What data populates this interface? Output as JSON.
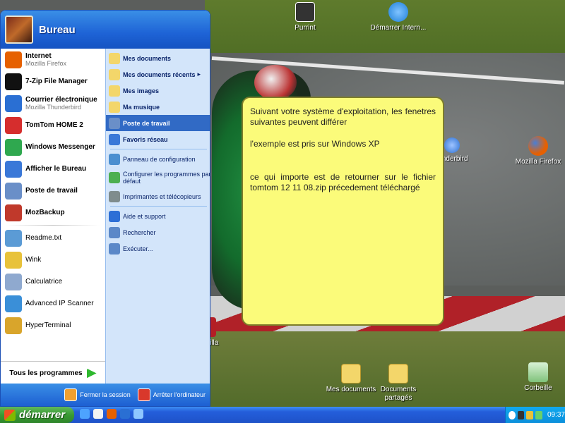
{
  "desktop": {
    "icons": [
      {
        "label": "Purrint",
        "icon": "purrint-icon",
        "color": "#333333"
      },
      {
        "label": "Démarrer Intern...",
        "icon": "internet-explorer-icon",
        "color": "#1e7fd8"
      },
      {
        "label": "Mozilla Firefox",
        "icon": "firefox-icon",
        "color": "#e66000"
      },
      {
        "label": "Mes documents",
        "icon": "my-documents-icon",
        "color": "#f3d66a"
      },
      {
        "label": "Documents partagés",
        "icon": "shared-documents-icon",
        "color": "#f3d66a"
      },
      {
        "label": "Corbeille",
        "icon": "recycle-bin-icon",
        "color": "#7fc27a"
      },
      {
        "label": "...Zilla",
        "icon": "filezilla-icon",
        "color": "#b41e25"
      },
      {
        "label": "...nderbird",
        "icon": "thunderbird-icon",
        "color": "#2a6fd3"
      }
    ]
  },
  "note": {
    "paragraphs": [
      "Suivant votre système d'exploitation, les fenetres suivantes peuvent différer",
      "l'exemple est pris sur Windows XP",
      "ce qui importe est de retourner sur le fichier tomtom 12 11 08.zip  précedement téléchargé"
    ]
  },
  "startmenu": {
    "username": "Bureau",
    "left_items": [
      {
        "title": "Internet",
        "subtitle": "Mozilla Firefox",
        "icon": "firefox-icon",
        "color": "#e66000",
        "bold": true
      },
      {
        "title": "7-Zip File Manager",
        "subtitle": "",
        "icon": "seven-zip-icon",
        "color": "#111111",
        "bold": true
      },
      {
        "title": "Courrier électronique",
        "subtitle": "Mozilla Thunderbird",
        "icon": "thunderbird-icon",
        "color": "#2a6fd3",
        "bold": true
      },
      {
        "title": "TomTom HOME 2",
        "subtitle": "",
        "icon": "tomtom-icon",
        "color": "#d62d2d",
        "bold": true
      },
      {
        "title": "Windows Messenger",
        "subtitle": "",
        "icon": "messenger-icon",
        "color": "#2fa84f",
        "bold": true
      },
      {
        "title": "Afficher le Bureau",
        "subtitle": "",
        "icon": "show-desktop-icon",
        "color": "#3a78d8",
        "bold": true
      },
      {
        "title": "Poste de travail",
        "subtitle": "",
        "icon": "my-computer-icon",
        "color": "#6a8fc8",
        "bold": true
      },
      {
        "title": "MozBackup",
        "subtitle": "",
        "icon": "mozbackup-icon",
        "color": "#c0392b",
        "bold": true
      },
      {
        "title": "Readme.txt",
        "subtitle": "",
        "icon": "text-file-icon",
        "color": "#5b9bd5",
        "bold": false
      },
      {
        "title": "Wink",
        "subtitle": "",
        "icon": "wink-icon",
        "color": "#e8c23a",
        "bold": false
      },
      {
        "title": "Calculatrice",
        "subtitle": "",
        "icon": "calculator-icon",
        "color": "#8fa9cf",
        "bold": false
      },
      {
        "title": "Advanced IP Scanner",
        "subtitle": "",
        "icon": "ip-scanner-icon",
        "color": "#3a8fd8",
        "bold": false
      },
      {
        "title": "HyperTerminal",
        "subtitle": "",
        "icon": "hyperterminal-icon",
        "color": "#d9a52b",
        "bold": false
      }
    ],
    "all_programs": "Tous les programmes",
    "right_items": [
      {
        "label": "Mes documents",
        "icon": "my-documents-icon",
        "color": "#f3d66a",
        "bold": true
      },
      {
        "label": "Mes documents récents",
        "icon": "recent-documents-icon",
        "color": "#f3d66a",
        "bold": true,
        "arrow": "▸"
      },
      {
        "label": "Mes images",
        "icon": "my-pictures-icon",
        "color": "#f3d66a",
        "bold": true
      },
      {
        "label": "Ma musique",
        "icon": "my-music-icon",
        "color": "#f3d66a",
        "bold": true
      },
      {
        "label": "Poste de travail",
        "icon": "my-computer-icon",
        "color": "#6a8fc8",
        "bold": true,
        "selected": true
      },
      {
        "label": "Favoris réseau",
        "icon": "network-places-icon",
        "color": "#3a78d8",
        "bold": true
      },
      {
        "label": "Panneau de configuration",
        "icon": "control-panel-icon",
        "color": "#4c8fd0",
        "bold": false
      },
      {
        "label": "Configurer les programmes par défaut",
        "icon": "default-programs-icon",
        "color": "#4caf50",
        "bold": false
      },
      {
        "label": "Imprimantes et télécopieurs",
        "icon": "printer-icon",
        "color": "#7f8c8d",
        "bold": false
      },
      {
        "label": "Aide et support",
        "icon": "help-icon",
        "color": "#2d6fd6",
        "bold": false
      },
      {
        "label": "Rechercher",
        "icon": "search-icon",
        "color": "#5b88c8",
        "bold": false
      },
      {
        "label": "Exécuter...",
        "icon": "run-icon",
        "color": "#5b88c8",
        "bold": false
      }
    ],
    "footer": {
      "logoff_label": "Fermer la session",
      "shutdown_label": "Arrêter l'ordinateur"
    }
  },
  "taskbar": {
    "start_label": "démarrer",
    "clock": "09:37"
  }
}
